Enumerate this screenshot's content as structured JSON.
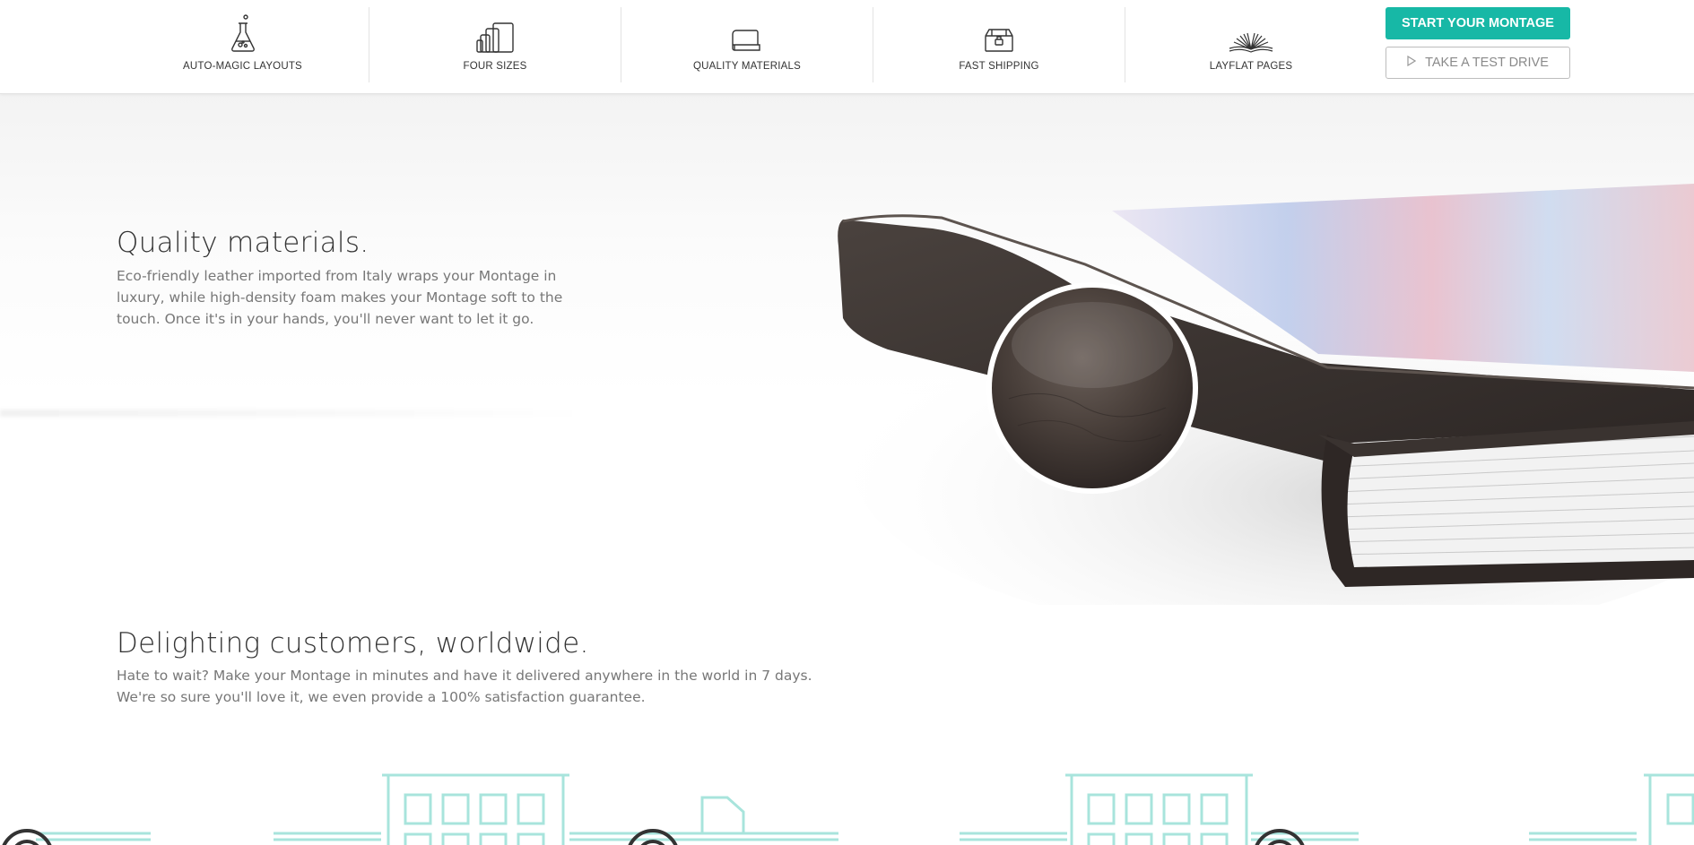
{
  "nav": {
    "features": [
      {
        "label": "AUTO-MAGIC LAYOUTS",
        "icon": "flask-icon"
      },
      {
        "label": "FOUR SIZES",
        "icon": "sizes-icon"
      },
      {
        "label": "QUALITY MATERIALS",
        "icon": "book-icon"
      },
      {
        "label": "FAST SHIPPING",
        "icon": "box-icon"
      },
      {
        "label": "LAYFLAT PAGES",
        "icon": "open-book-icon"
      }
    ],
    "start_button": "START YOUR MONTAGE",
    "test_drive_button": "TAKE A TEST DRIVE",
    "test_drive_icon": "play-icon"
  },
  "quality": {
    "title": "Quality materials.",
    "body": "Eco-friendly leather imported from Italy wraps your Montage in luxury, while high-density foam makes your Montage soft to the touch. Once it's in your hands, you'll never want to let it go."
  },
  "delight": {
    "title": "Delighting customers, worldwide.",
    "body": "Hate to wait? Make your Montage in minutes and have it delivered anywhere in the world in 7 days. We're so sure you'll love it, we even provide a 100% satisfaction guarantee."
  },
  "colors": {
    "accent": "#17b8a6",
    "city_line": "#a8e4dc",
    "leather": "#3d3532",
    "text_dark": "#333333",
    "text_body": "#777777"
  }
}
